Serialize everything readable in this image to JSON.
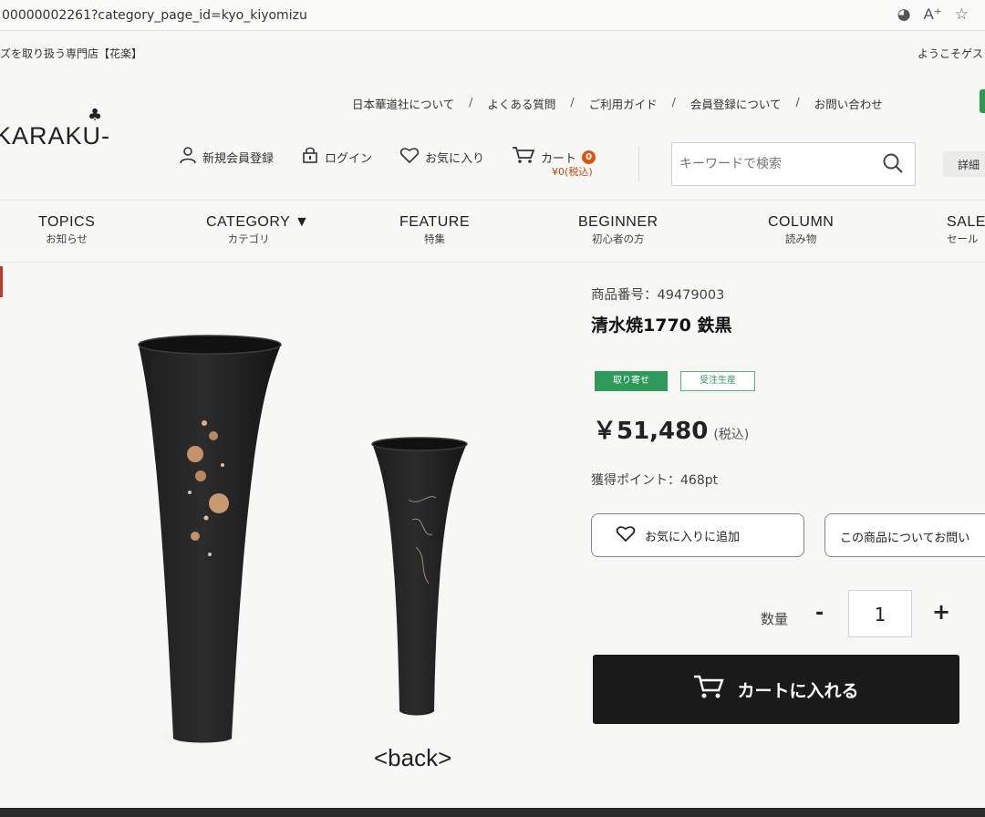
{
  "browser": {
    "url": "00000002261?category_page_id=kyo_kiyomizu",
    "icons": [
      "eye-slash-icon",
      "read-aloud-icon",
      "star-icon"
    ]
  },
  "announce": {
    "left": "ズを取り扱う専門店【花楽】",
    "right": "ようこそゲス"
  },
  "header": {
    "logo": "KARAKU-",
    "subnav": [
      "日本華道社について",
      "よくある質問",
      "ご利用ガイド",
      "会員登録について",
      "お問い合わせ"
    ],
    "separator": "/",
    "member": {
      "register": "新規会員登録",
      "login": "ログイン",
      "favorites": "お気に入り",
      "cart": "カート",
      "cart_count": "0",
      "cart_total": "¥0(税込)"
    },
    "search": {
      "placeholder": "キーワードで検索"
    },
    "detail_button": "詳細"
  },
  "gnav": [
    {
      "en": "TOPICS",
      "ja": "お知らせ"
    },
    {
      "en": "CATEGORY ▼",
      "ja": "カテゴリ"
    },
    {
      "en": "FEATURE",
      "ja": "特集"
    },
    {
      "en": "BEGINNER",
      "ja": "初心者の方"
    },
    {
      "en": "COLUMN",
      "ja": "読み物"
    },
    {
      "en": "SALE",
      "ja": "セール"
    }
  ],
  "product": {
    "sku": "商品番号：49479003",
    "name": "清水焼1770 鉄黒",
    "tag_primary": "取り寄せ",
    "tag_secondary": "受注生産",
    "price": "￥51,480",
    "price_tax": "(税込)",
    "points": "獲得ポイント：468pt",
    "favorite_button": "お気に入りに追加",
    "inquiry_button": "この商品についてお問い",
    "quantity_label": "数量",
    "quantity_minus": "-",
    "quantity_value": "1",
    "quantity_plus": "+",
    "add_to_cart": "カートに入れる",
    "back_link": "<back>"
  },
  "colors": {
    "accent_green": "#2e9a5a",
    "cart_badge": "#d9570e",
    "cart_button": "#1a1a1a"
  }
}
